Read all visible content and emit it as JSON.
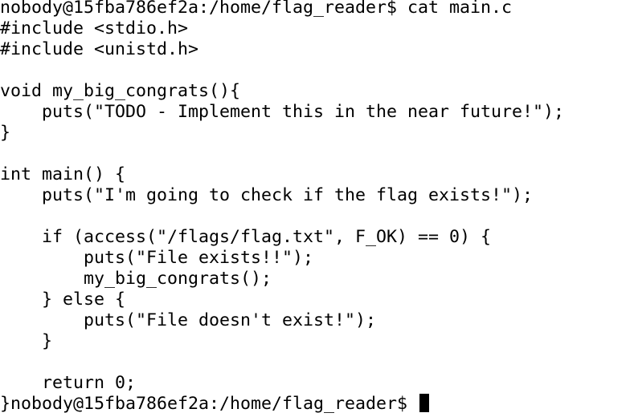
{
  "terminal": {
    "lines": [
      "nobody@15fba786ef2a:/home/flag_reader$ cat main.c",
      "#include <stdio.h>",
      "#include <unistd.h>",
      "",
      "void my_big_congrats(){",
      "    puts(\"TODO - Implement this in the near future!\");",
      "}",
      "",
      "int main() {",
      "    puts(\"I'm going to check if the flag exists!\");",
      "",
      "    if (access(\"/flags/flag.txt\", F_OK) == 0) {",
      "        puts(\"File exists!!\");",
      "        my_big_congrats();",
      "    } else {",
      "        puts(\"File doesn't exist!\");",
      "    }",
      "",
      "    return 0;"
    ],
    "last_line": "}nobody@15fba786ef2a:/home/flag_reader$ "
  }
}
